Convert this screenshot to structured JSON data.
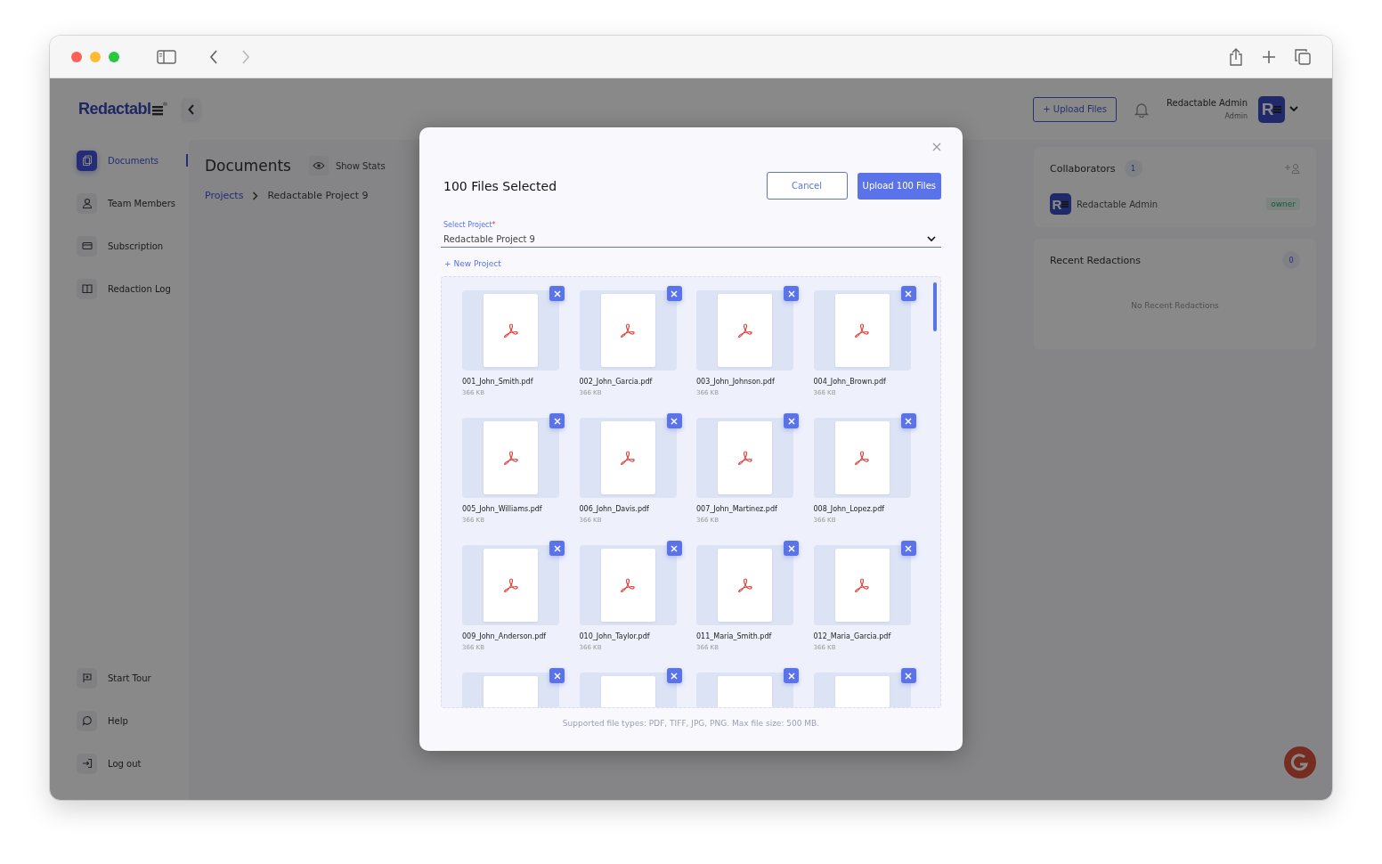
{
  "app": {
    "logo": "Redactabl",
    "logo_mark": "®",
    "upload_button": "+ Upload Files",
    "user": {
      "name": "Redactable Admin",
      "role": "Admin",
      "initial": "R"
    }
  },
  "sidebar": {
    "items": [
      {
        "label": "Documents",
        "kind": "documents",
        "selected": true
      },
      {
        "label": "Team Members",
        "kind": "person",
        "selected": false
      },
      {
        "label": "Subscription",
        "kind": "card",
        "selected": false
      },
      {
        "label": "Redaction Log",
        "kind": "book",
        "selected": false
      }
    ],
    "bottom_items": [
      {
        "label": "Start Tour",
        "kind": "flag"
      },
      {
        "label": "Help",
        "kind": "chat"
      },
      {
        "label": "Log out",
        "kind": "logout"
      }
    ]
  },
  "page": {
    "title": "Documents",
    "stats_button": "Show Stats",
    "breadcrumb": [
      "Projects",
      "Redactable Project 9"
    ]
  },
  "collaborators": {
    "title": "Collaborators",
    "count": "1",
    "members": [
      {
        "name": "Redactable Admin",
        "initial": "R",
        "role": "owner"
      }
    ]
  },
  "recent_redactions": {
    "title": "Recent Redactions",
    "count": "0",
    "empty_text": "No Recent Redactions"
  },
  "modal": {
    "title": "100 Files Selected",
    "cancel": "Cancel",
    "upload": "Upload 100 Files",
    "project_field": {
      "label": "Select Project",
      "required_mark": "*",
      "value": "Redactable Project 9"
    },
    "new_project": "+ New Project",
    "files": [
      {
        "kind": "full",
        "name": "001_John_Smith.pdf",
        "size": "366 KB"
      },
      {
        "kind": "full",
        "name": "002_John_Garcia.pdf",
        "size": "366 KB"
      },
      {
        "kind": "full",
        "name": "003_John_Johnson.pdf",
        "size": "366 KB"
      },
      {
        "kind": "full",
        "name": "004_John_Brown.pdf",
        "size": "366 KB"
      },
      {
        "kind": "full",
        "name": "005_John_Williams.pdf",
        "size": "366 KB"
      },
      {
        "kind": "full",
        "name": "006_John_Davis.pdf",
        "size": "366 KB"
      },
      {
        "kind": "full",
        "name": "007_John_Martinez.pdf",
        "size": "366 KB"
      },
      {
        "kind": "full",
        "name": "008_John_Lopez.pdf",
        "size": "366 KB"
      },
      {
        "kind": "full",
        "name": "009_John_Anderson.pdf",
        "size": "366 KB"
      },
      {
        "kind": "full",
        "name": "010_John_Taylor.pdf",
        "size": "366 KB"
      },
      {
        "kind": "full",
        "name": "011_Maria_Smith.pdf",
        "size": "366 KB"
      },
      {
        "kind": "full",
        "name": "012_Maria_Garcia.pdf",
        "size": "366 KB"
      },
      {
        "kind": "partial"
      },
      {
        "kind": "partial"
      },
      {
        "kind": "partial"
      },
      {
        "kind": "partial"
      }
    ],
    "footnote": "Supported file types: PDF, TIFF, JPG, PNG. Max file size: 500 MB."
  }
}
